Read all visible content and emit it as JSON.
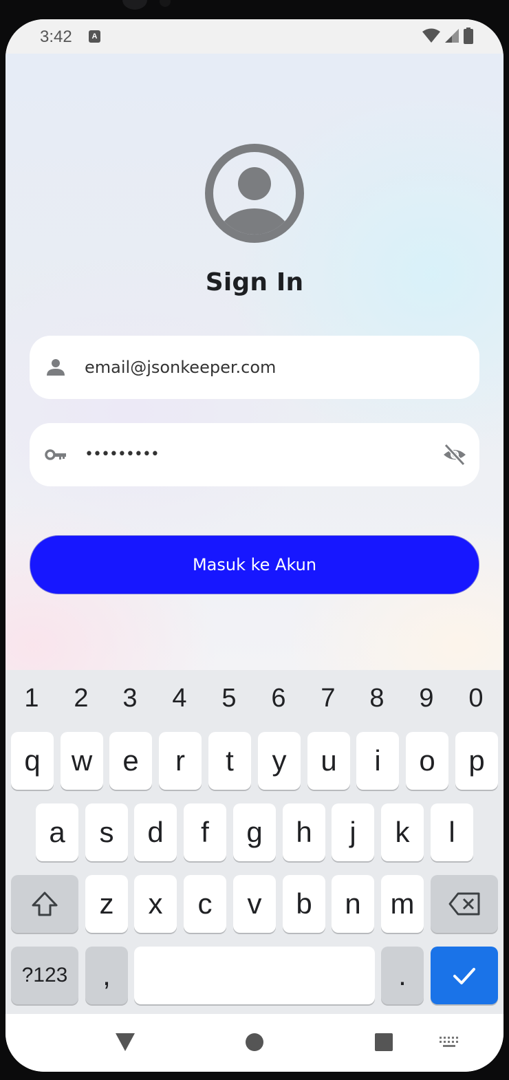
{
  "status_bar": {
    "time": "3:42",
    "notif_letter": "A"
  },
  "login": {
    "title": "Sign In",
    "email_value": "email@jsonkeeper.com",
    "password_value": "•••••••••",
    "submit_label": "Masuk ke Akun"
  },
  "keyboard": {
    "numbers": [
      "1",
      "2",
      "3",
      "4",
      "5",
      "6",
      "7",
      "8",
      "9",
      "0"
    ],
    "row1": [
      "q",
      "w",
      "e",
      "r",
      "t",
      "y",
      "u",
      "i",
      "o",
      "p"
    ],
    "row2": [
      "a",
      "s",
      "d",
      "f",
      "g",
      "h",
      "j",
      "k",
      "l"
    ],
    "row3": [
      "z",
      "x",
      "c",
      "v",
      "b",
      "n",
      "m"
    ],
    "symbols_label": "?123",
    "comma_label": ",",
    "period_label": "."
  },
  "colors": {
    "primary_button": "#1717ff",
    "enter_key": "#1a73e8",
    "icon_gray": "#7b7d80"
  }
}
